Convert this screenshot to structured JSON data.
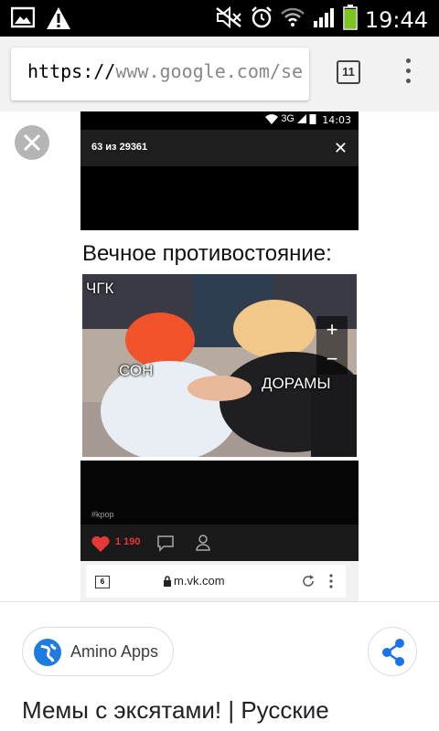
{
  "status_bar": {
    "time": "19:44",
    "icons": [
      "image-notification-icon",
      "warning-icon",
      "mute-icon",
      "alarm-icon",
      "wifi-icon",
      "signal-icon",
      "battery-icon"
    ],
    "battery_color": "#7cc61b"
  },
  "browser": {
    "url_scheme": "https://",
    "url_rest": "www.google.com/se",
    "tab_count": "11"
  },
  "image_preview": {
    "inner_status_time": "14:03",
    "inner_status_network": "3G",
    "viewer_counter": "63 из 29361",
    "caption": "Вечное противостояние:",
    "photo_labels": {
      "top_left": "ЧГК",
      "left": "СОН",
      "right": "ДОРАМЫ"
    },
    "hashtag": "#kpop",
    "likes": "1 190",
    "vk_tab_count": "6",
    "vk_url": "m.vk.com",
    "accent_like": "#e53935"
  },
  "result": {
    "source_chip": "Amino Apps",
    "title": "Мемы с эксятами! | Русские"
  }
}
